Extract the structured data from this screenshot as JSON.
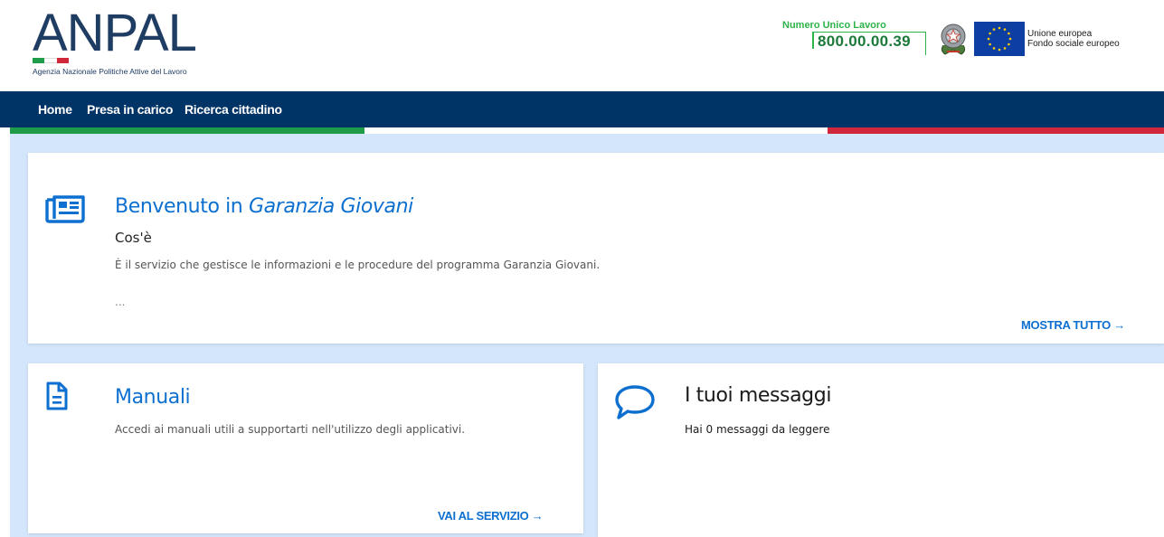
{
  "header": {
    "logo": {
      "wordmark": "ANPAL",
      "subtitle": "Agenzia Nazionale Politiche Attive del Lavoro",
      "flag_colors": [
        "#1f9c4a",
        "#ffffff",
        "#d0283a"
      ]
    },
    "numero_unico": {
      "label": "Numero Unico Lavoro",
      "number": "800.00.00.39",
      "color": "#2db34a"
    },
    "emblem_icon": "italian-republic-emblem",
    "eu": {
      "flag_icon": "eu-flag",
      "line1": "Unione europea",
      "line2": "Fondo sociale europeo"
    }
  },
  "nav": {
    "background": "#003366",
    "items": [
      {
        "label": "Home"
      },
      {
        "label": "Presa in carico"
      },
      {
        "label": "Ricerca cittadino"
      }
    ]
  },
  "main_card": {
    "icon": "newspaper-icon",
    "title_prefix": "Benvenuto in",
    "title_emphasis": "Garanzia Giovani",
    "subtitle": "Cos'è",
    "description": "È il servizio che gestisce le informazioni e le procedure del programma Garanzia Giovani.",
    "ellipsis": "...",
    "link": "MOSTRA TUTTO →"
  },
  "manuali_card": {
    "icon": "document-icon",
    "title": "Manuali",
    "description": "Accedi ai manuali utili a supportarti nell'utilizzo degli applicativi.",
    "link": "VAI AL SERVIZIO →"
  },
  "messaggi_card": {
    "icon": "chat-bubble-icon",
    "title": "I tuoi messaggi",
    "text": "Hai 0 messaggi da leggere"
  },
  "colors": {
    "accent": "#0d6fcf",
    "page_bg": "#d4e6fb",
    "brand": "#1f3c63"
  }
}
